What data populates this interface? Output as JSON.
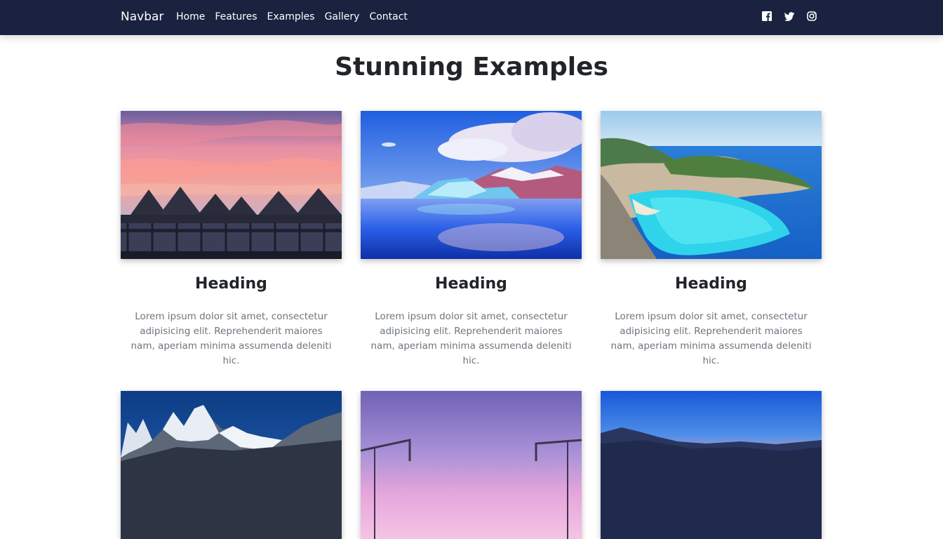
{
  "navbar": {
    "brand": "Navbar",
    "links": [
      "Home",
      "Features",
      "Examples",
      "Gallery",
      "Contact"
    ],
    "social_icons": [
      "facebook-icon",
      "twitter-icon",
      "instagram-icon"
    ],
    "background": "#1b2240"
  },
  "page": {
    "title": "Stunning Examples"
  },
  "cards": [
    {
      "image": "overwater-bungalows-sunset",
      "heading": "Heading",
      "text": "Lorem ipsum dolor sit amet, consectetur adipisicing elit. Reprehenderit maiores nam, aperiam minima assumenda deleniti hic."
    },
    {
      "image": "iceberg-lake-reflection",
      "heading": "Heading",
      "text": "Lorem ipsum dolor sit amet, consectetur adipisicing elit. Reprehenderit maiores nam, aperiam minima assumenda deleniti hic."
    },
    {
      "image": "turquoise-cove-cliffs",
      "heading": "Heading",
      "text": "Lorem ipsum dolor sit amet, consectetur adipisicing elit. Reprehenderit maiores nam, aperiam minima assumenda deleniti hic."
    },
    {
      "image": "snowy-mountain-peaks"
    },
    {
      "image": "purple-sky-bridge"
    },
    {
      "image": "mountain-valley-dusk"
    }
  ]
}
